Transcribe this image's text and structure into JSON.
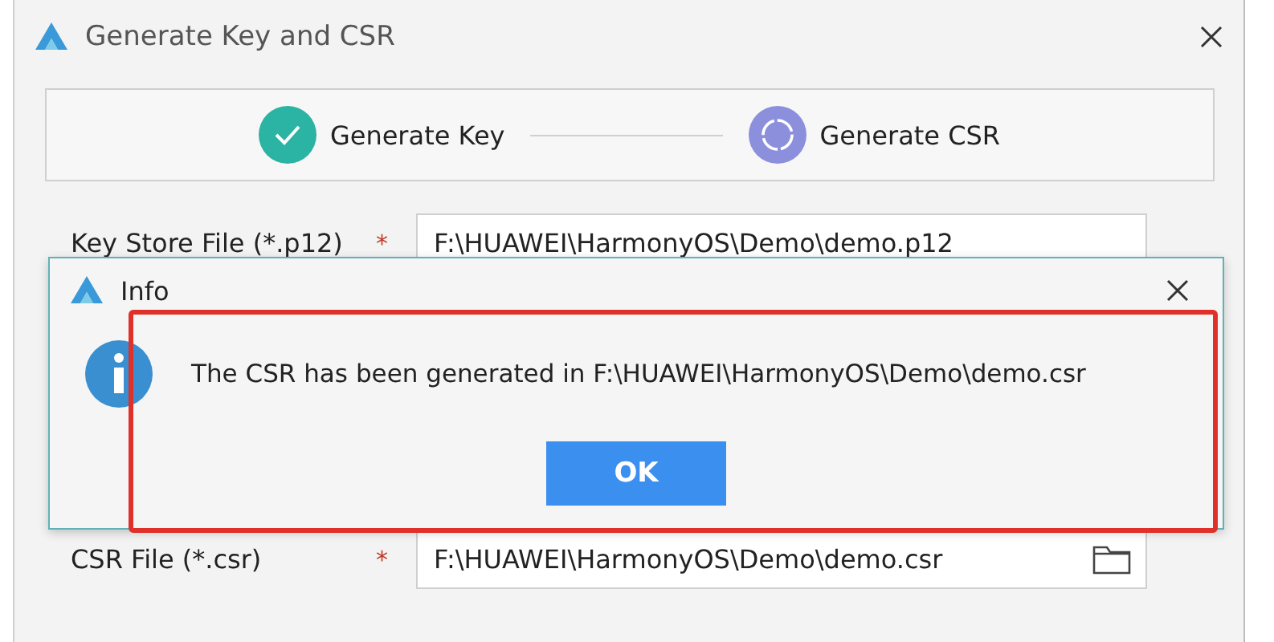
{
  "window": {
    "title": "Generate Key and CSR"
  },
  "steps": [
    {
      "label": "Generate Key",
      "done": true
    },
    {
      "label": "Generate CSR",
      "done": false
    }
  ],
  "fields": [
    {
      "label": "Key Store File (*.p12)",
      "required_mark": "*",
      "value": "F:\\HUAWEI\\HarmonyOS\\Demo\\demo.p12",
      "browse": false
    },
    {
      "label": "CSR File (*.csr)",
      "required_mark": "*",
      "value": "F:\\HUAWEI\\HarmonyOS\\Demo\\demo.csr",
      "browse": true
    }
  ],
  "info_dialog": {
    "title": "Info",
    "message": "The CSR has been generated in F:\\HUAWEI\\HarmonyOS\\Demo\\demo.csr",
    "button": "OK"
  }
}
